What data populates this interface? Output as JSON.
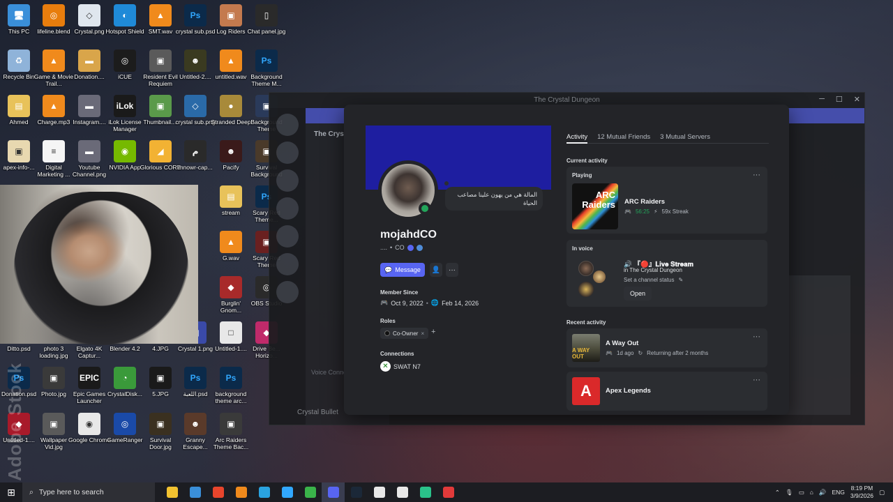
{
  "desktop": {
    "icons": [
      {
        "label": "This PC",
        "color": "#3a8fd9",
        "glyph": "🖥"
      },
      {
        "label": "lifeline.blend",
        "color": "#e87d0d",
        "glyph": "◎"
      },
      {
        "label": "Crystal.png",
        "color": "#dfe6ee",
        "glyph": "◇"
      },
      {
        "label": "Hotspot Shield",
        "color": "#1f8ad8",
        "glyph": "◐"
      },
      {
        "label": "SMT.wav",
        "color": "#f08a1c",
        "glyph": "▲"
      },
      {
        "label": "crystal sub.psd",
        "color": "#0b2a4a",
        "glyph": "Ps"
      },
      {
        "label": "Log Riders",
        "color": "#c47a4e",
        "glyph": "▣"
      },
      {
        "label": "Chat panel.jpg",
        "color": "#2a2a2a",
        "glyph": "▯"
      },
      {
        "label": "Recycle Bin",
        "color": "#8fb3d9",
        "glyph": "♻"
      },
      {
        "label": "Game & Movie Trail...",
        "color": "#f08a1c",
        "glyph": "▲"
      },
      {
        "label": "Donation....",
        "color": "#d9a54a",
        "glyph": "▬"
      },
      {
        "label": "iCUE",
        "color": "#1c1c1c",
        "glyph": "◎"
      },
      {
        "label": "Resident Evil Requiem",
        "color": "#5a5a5a",
        "glyph": "▣"
      },
      {
        "label": "Untitled-2....",
        "color": "#3a3a20",
        "glyph": "☻"
      },
      {
        "label": "untitled.wav",
        "color": "#f08a1c",
        "glyph": "▲"
      },
      {
        "label": "Background Theme M...",
        "color": "#0b2a4a",
        "glyph": "Ps"
      },
      {
        "label": "Ahmed",
        "color": "#e8c25a",
        "glyph": "▤"
      },
      {
        "label": "Charge.mp3",
        "color": "#f08a1c",
        "glyph": "▲"
      },
      {
        "label": "Instagram....",
        "color": "#6a6a78",
        "glyph": "▬"
      },
      {
        "label": "iLok License Manager",
        "color": "#1a1a1a",
        "glyph": "iLok"
      },
      {
        "label": "Thumbnail....",
        "color": "#5a9a4a",
        "glyph": "▣"
      },
      {
        "label": "crystal sub.png",
        "color": "#2a6aa8",
        "glyph": "◇"
      },
      {
        "label": "Stranded Deep",
        "color": "#a88a3a",
        "glyph": "●"
      },
      {
        "label": "Background Theme",
        "color": "#2a3a5a",
        "glyph": "▣"
      },
      {
        "label": "apex-info-...",
        "color": "#e8d8b0",
        "glyph": "▣"
      },
      {
        "label": "Digital Marketing ...",
        "color": "#f5f5f5",
        "glyph": "≡"
      },
      {
        "label": "Youtube Channel.png",
        "color": "#6a6a78",
        "glyph": "▬"
      },
      {
        "label": "NVIDIA App",
        "color": "#76b900",
        "glyph": "◉"
      },
      {
        "label": "Glorious CORE",
        "color": "#f2b233",
        "glyph": "◢"
      },
      {
        "label": "mnowr-cap...",
        "color": "#2a2a2a",
        "glyph": "م"
      },
      {
        "label": "Pacify",
        "color": "#3a1a1a",
        "glyph": "☻"
      },
      {
        "label": "Survival Background",
        "color": "#4a3a2a",
        "glyph": "▣"
      },
      {
        "label": "stream",
        "color": "#e8c25a",
        "glyph": "▤"
      },
      {
        "label": "Scary Red Theme...",
        "color": "#0b2a4a",
        "glyph": "Ps"
      },
      {
        "label": "G.wav",
        "color": "#f08a1c",
        "glyph": "▲"
      },
      {
        "label": "Scary Red Theme",
        "color": "#6a2020",
        "glyph": "▣"
      },
      {
        "label": "Burglin' Gnom...",
        "color": "#a82a2a",
        "glyph": "◆"
      },
      {
        "label": "OBS Studio",
        "color": "#2a2a2a",
        "glyph": "◎"
      },
      {
        "label": "Ditto.psd",
        "color": "#0b2a4a",
        "glyph": "Ps"
      },
      {
        "label": "photo 3 loading.jpg",
        "color": "#2a2a2a",
        "glyph": "▣"
      },
      {
        "label": "Elgato 4K Captur...",
        "color": "#1a1a1a",
        "glyph": "▣"
      },
      {
        "label": "Blender 4.2",
        "color": "#f5f5f5",
        "glyph": "□"
      },
      {
        "label": "4.JPG",
        "color": "#1a1a1a",
        "glyph": "▣"
      },
      {
        "label": "Crystal 1.png",
        "color": "#3a4aa8",
        "glyph": "▣"
      },
      {
        "label": "Untitled-1....",
        "color": "#e8e8e8",
        "glyph": "□"
      },
      {
        "label": "Drive Be... Horizo...",
        "color": "#c02a6a",
        "glyph": "◆"
      },
      {
        "label": "Donation.psd",
        "color": "#0b2a4a",
        "glyph": "Ps"
      },
      {
        "label": "Photo.jpg",
        "color": "#3a3a3a",
        "glyph": "▣"
      },
      {
        "label": "Epic Games Launcher",
        "color": "#1a1a1a",
        "glyph": "EPIC"
      },
      {
        "label": "CrystalDisk...",
        "color": "#3a9a3a",
        "glyph": "◔"
      },
      {
        "label": "5.JPG",
        "color": "#1a1a1a",
        "glyph": "▣"
      },
      {
        "label": "اللعبة.psd",
        "color": "#0b2a4a",
        "glyph": "Ps"
      },
      {
        "label": "background theme arc...",
        "color": "#0b2a4a",
        "glyph": "Ps"
      },
      {
        "label": "Untitled-1....",
        "color": "#a81a2a",
        "glyph": "◆"
      },
      {
        "label": "Wallpaper Vid.jpg",
        "color": "#5a5a5a",
        "glyph": "▣"
      },
      {
        "label": "Google Chrome",
        "color": "#e8e8e8",
        "glyph": "◉"
      },
      {
        "label": "GameRanger",
        "color": "#1a4aa8",
        "glyph": "◎"
      },
      {
        "label": "Survival Door.jpg",
        "color": "#3a3020",
        "glyph": "▣"
      },
      {
        "label": "Granny Escape...",
        "color": "#5a3a2a",
        "glyph": "☻"
      },
      {
        "label": "Arc Raiders Theme Bac...",
        "color": "#3a3a3a",
        "glyph": "▣"
      }
    ]
  },
  "watermark": "Adobe Stock",
  "bg_window": {
    "title": "The Crystal Dungeon",
    "server_name": "The Crys",
    "voice_label": "Voice Connected",
    "user_label": "Crystal Bullet"
  },
  "profile": {
    "status_message": "المالة هي من يهون علينا مصاعب الحياة",
    "display_name": "mojahdCO",
    "tagline_dots": "....",
    "tagline_bullet": "•",
    "tagline_tag": "CO",
    "message_button": "Message",
    "member_since_label": "Member Since",
    "member_since_discord": "Oct 9, 2022",
    "member_since_server": "Feb 14, 2026",
    "roles_label": "Roles",
    "role_name": "Co-Owner",
    "role_remove": "×",
    "role_add": "+",
    "connections_label": "Connections",
    "connection_name": "SWAT N7"
  },
  "right_panel": {
    "tabs": [
      "Activity",
      "12 Mutual Friends",
      "3 Mutual Servers"
    ],
    "current_activity_label": "Current activity",
    "playing_label": "Playing",
    "playing_game": "ARC Raiders",
    "playing_art_text": "ARC Raiders",
    "playing_time": "56:25",
    "playing_streak": "59x Streak",
    "in_voice_label": "In voice",
    "voice_channel": "『🔴』𝐋𝐢𝐯𝐞 𝐒𝐭𝐫𝐞𝐚𝐦",
    "voice_server": "in The Crystal Dungeon",
    "set_status": "Set a channel status",
    "open_button": "Open",
    "recent_activity_label": "Recent activity",
    "recent": [
      {
        "game": "A Way Out",
        "art": "A WAY OUT",
        "ago": "1d ago",
        "note": "Returning after 2 months"
      },
      {
        "game": "Apex Legends",
        "art": "A"
      }
    ]
  },
  "taskbar": {
    "search_placeholder": "Type here to search",
    "language": "ENG",
    "time": "8:19 PM",
    "date": "3/9/2026",
    "apps": [
      {
        "name": "file-explorer",
        "color": "#f2c230"
      },
      {
        "name": "window-app",
        "color": "#3a8fd9"
      },
      {
        "name": "chrome",
        "color": "#e8452c"
      },
      {
        "name": "vlc",
        "color": "#f08a1c"
      },
      {
        "name": "telegram",
        "color": "#2aa3e0"
      },
      {
        "name": "photoshop",
        "color": "#31a8ff"
      },
      {
        "name": "shield",
        "color": "#3ab34a"
      },
      {
        "name": "discord",
        "color": "#5865f2"
      },
      {
        "name": "steam",
        "color": "#1b2838"
      },
      {
        "name": "epic",
        "color": "#e8e8e8"
      },
      {
        "name": "capcut",
        "color": "#e8e8e8"
      },
      {
        "name": "app-green",
        "color": "#2ac28a"
      },
      {
        "name": "obs",
        "color": "#e23a3a"
      }
    ]
  }
}
